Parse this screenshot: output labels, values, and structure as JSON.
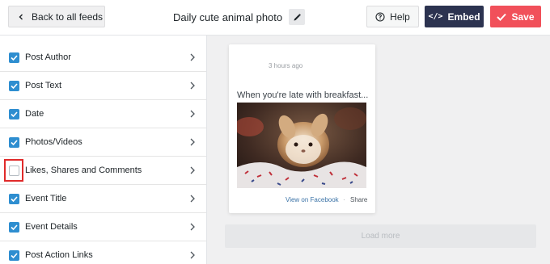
{
  "header": {
    "back_label": "Back to all feeds",
    "feed_title": "Daily cute animal photo",
    "help_label": "Help",
    "embed_label": "Embed",
    "save_label": "Save"
  },
  "sidebar": {
    "items": [
      {
        "label": "Post Author",
        "checked": true
      },
      {
        "label": "Post Text",
        "checked": true
      },
      {
        "label": "Date",
        "checked": true
      },
      {
        "label": "Photos/Videos",
        "checked": true
      },
      {
        "label": "Likes, Shares and Comments",
        "checked": false
      },
      {
        "label": "Event Title",
        "checked": true
      },
      {
        "label": "Event Details",
        "checked": true
      },
      {
        "label": "Post Action Links",
        "checked": true
      }
    ]
  },
  "preview": {
    "time": "3 hours ago",
    "text": "When you're late with breakfast...",
    "view_link": "View on Facebook",
    "separator": "·",
    "share_label": "Share",
    "load_more": "Load more"
  },
  "colors": {
    "accent_checkbox": "#2e8ed0",
    "embed_bg": "#2c3350",
    "save_bg": "#f1505a",
    "highlight": "#e02a2a"
  }
}
